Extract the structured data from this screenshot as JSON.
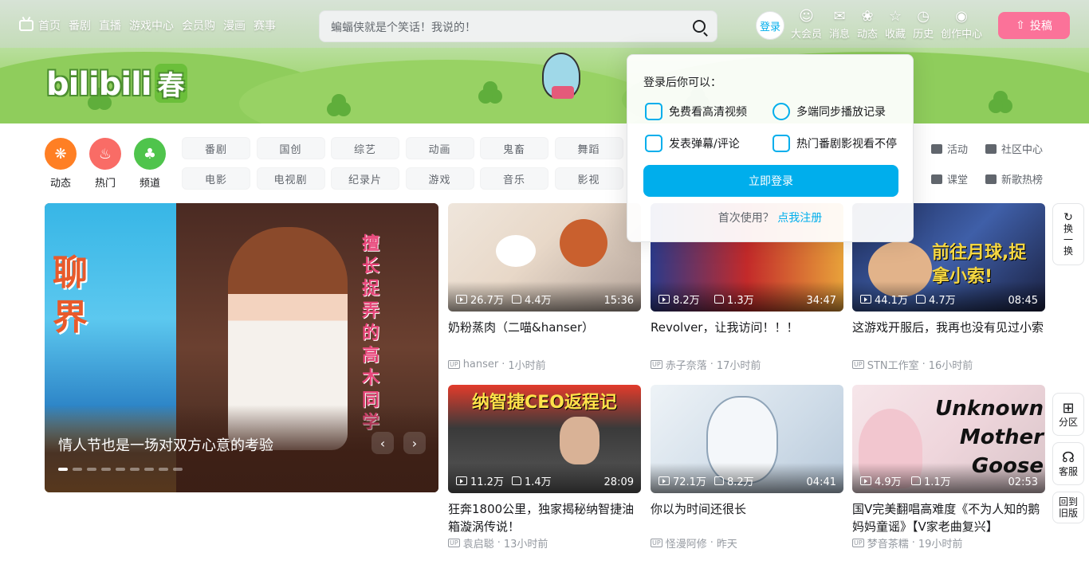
{
  "nav": {
    "home": "首页",
    "items": [
      "番剧",
      "直播",
      "游戏中心",
      "会员购",
      "漫画",
      "赛事"
    ]
  },
  "search": {
    "placeholder": "蝙蝠侠就是个笑话！我说的！"
  },
  "header_right": {
    "login": "登录",
    "icons": [
      {
        "label": "大会员",
        "icon": "vip-icon"
      },
      {
        "label": "消息",
        "icon": "message-icon"
      },
      {
        "label": "动态",
        "icon": "dynamic-icon"
      },
      {
        "label": "收藏",
        "icon": "star-icon"
      },
      {
        "label": "历史",
        "icon": "history-icon"
      },
      {
        "label": "创作中心",
        "icon": "creator-icon"
      }
    ],
    "upload": "投稿"
  },
  "logo": {
    "text": "bilibili",
    "sub": "春"
  },
  "channels": {
    "circles": [
      {
        "label": "动态",
        "color": "#ff7f24"
      },
      {
        "label": "热门",
        "color": "#f96c66"
      },
      {
        "label": "频道",
        "color": "#4fc44c"
      }
    ],
    "tags": [
      "番剧",
      "国创",
      "综艺",
      "动画",
      "鬼畜",
      "舞蹈",
      "电影",
      "电视剧",
      "纪录片",
      "游戏",
      "音乐",
      "影视"
    ],
    "side_links": [
      "活动",
      "社区中心",
      "课堂",
      "新歌热榜"
    ]
  },
  "carousel": {
    "caption": "情人节也是一场对双方心意的考验",
    "poster_text": "擅长捉弄的高木同学",
    "poster_left": "聊界",
    "dots": 9
  },
  "videos": [
    {
      "title": "奶粉蒸肉（二喵&hanser）",
      "plays": "26.7万",
      "likes": "4.4万",
      "duration": "15:36",
      "author": "hanser",
      "time": "1小时前"
    },
    {
      "title": "Revolver，让我访问！！！",
      "plays": "8.2万",
      "likes": "1.3万",
      "duration": "34:47",
      "author": "赤子奈落",
      "time": "17小时前"
    },
    {
      "title": "这游戏开服后，我再也没有见过小索",
      "plays": "44.1万",
      "likes": "4.7万",
      "duration": "08:45",
      "author": "STN工作室",
      "time": "16小时前"
    },
    {
      "title": "狂奔1800公里，独家揭秘纳智捷油箱漩涡传说！",
      "plays": "11.2万",
      "likes": "1.4万",
      "duration": "28:09",
      "author": "袁启聪",
      "time": "13小时前"
    },
    {
      "title": "你以为时间还很长",
      "plays": "72.1万",
      "likes": "8.2万",
      "duration": "04:41",
      "author": "怪漫阿修",
      "time": "昨天"
    },
    {
      "title": "国V完美翻唱高难度《不为人知的鹅妈妈童谣》【V家老曲复兴】",
      "plays": "4.9万",
      "likes": "1.1万",
      "duration": "02:53",
      "author": "梦音茶糯",
      "time": "19小时前"
    }
  ],
  "thumb_texts": {
    "v3": "前往月球,捉拿小索!",
    "v4": "纳智捷CEO返程记",
    "v6": "Unknown Mother Goose"
  },
  "popup": {
    "heading": "登录后你可以：",
    "features": [
      {
        "label": "免费看高清视频",
        "icon": "hd-icon"
      },
      {
        "label": "多端同步播放记录",
        "icon": "clock-icon"
      },
      {
        "label": "发表弹幕/评论",
        "icon": "list-icon"
      },
      {
        "label": "热门番剧影视看不停",
        "icon": "play-icon"
      }
    ],
    "button": "立即登录",
    "footer_text": "首次使用？",
    "footer_link": "点我注册"
  },
  "fixed_side": {
    "refresh": "换一换",
    "refresh_chars": [
      "换",
      "一",
      "换"
    ],
    "category": "分区",
    "service": "客服",
    "old": "回到旧版"
  },
  "colors": {
    "accent": "#00aeec",
    "pink": "#fb7299",
    "text_gray": "#9499a0"
  }
}
